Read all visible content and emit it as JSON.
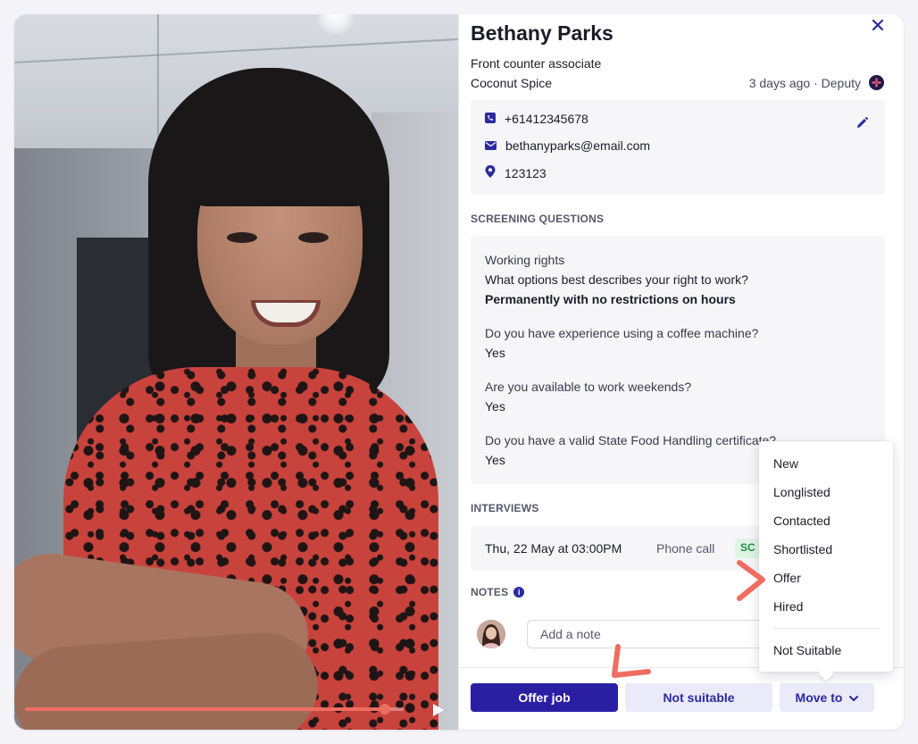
{
  "candidate": {
    "name": "Bethany Parks",
    "role": "Front counter associate",
    "company": "Coconut Spice",
    "source": "3 days ago · Deputy"
  },
  "contact": {
    "phone": "+61412345678",
    "email": "bethanyparks@email.com",
    "postcode": "123123"
  },
  "screening": {
    "heading": "SCREENING QUESTIONS",
    "items": [
      {
        "category": "Working rights",
        "question": "What options best describes your right to work?",
        "answer": "Permanently with no restrictions on hours"
      },
      {
        "question": "Do you have experience using a coffee machine?",
        "answer": "Yes"
      },
      {
        "question": "Are you available to work weekends?",
        "answer": "Yes"
      },
      {
        "question": "Do you have a valid State Food Handling certificate?",
        "answer": "Yes"
      }
    ]
  },
  "interviews": {
    "heading": "INTERVIEWS",
    "items": [
      {
        "datetime": "Thu, 22 May at 03:00PM",
        "type": "Phone call",
        "status": "SC"
      }
    ]
  },
  "notes": {
    "heading": "NOTES",
    "placeholder": "Add a note"
  },
  "actions": {
    "offer": "Offer job",
    "not_suitable": "Not suitable",
    "move_to": "Move to"
  },
  "move_menu": {
    "items": [
      "New",
      "Longlisted",
      "Contacted",
      "Shortlisted",
      "Offer",
      "Hired"
    ],
    "footer_item": "Not Suitable"
  },
  "video": {
    "progress": 0.95
  },
  "colors": {
    "brand": "#2a1fa3",
    "accent": "#2b2aa0",
    "button_secondary_bg": "#ebeaf8",
    "annotation": "#ee6d60",
    "status_green": "#1f8a46"
  },
  "icons": [
    "close-icon",
    "phone-icon",
    "email-icon",
    "location-icon",
    "edit-icon",
    "info-icon",
    "play-icon",
    "chevron-down-icon",
    "deputy-logo"
  ]
}
